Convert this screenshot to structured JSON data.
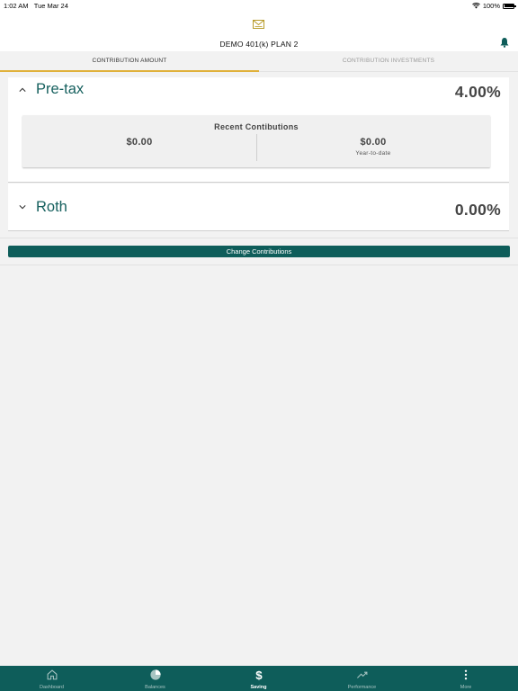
{
  "status_bar": {
    "time": "1:02 AM",
    "date": "Tue Mar 24",
    "battery": "100%"
  },
  "header": {
    "plan_name": "DEMO 401(k) PLAN 2"
  },
  "tabs": [
    {
      "label": "CONTRIBUTION AMOUNT",
      "active": true
    },
    {
      "label": "CONTRIBUTION INVESTMENTS",
      "active": false
    }
  ],
  "pretax": {
    "label": "Pre-tax",
    "percent": "4.00%",
    "expanded": true,
    "recent": {
      "title": "Recent Contibutions",
      "left_amount": "$0.00",
      "right_amount": "$0.00",
      "right_caption": "Year-to-date"
    }
  },
  "roth": {
    "label": "Roth",
    "percent": "0.00%",
    "expanded": false
  },
  "change_button": "Change Contributions",
  "bottom_nav": [
    {
      "label": "Dashboard",
      "icon": "home-icon",
      "active": false
    },
    {
      "label": "Balances",
      "icon": "pie-chart-icon",
      "active": false
    },
    {
      "label": "Saving",
      "icon": "dollar-icon",
      "active": true
    },
    {
      "label": "Performance",
      "icon": "trend-icon",
      "active": false
    },
    {
      "label": "More",
      "icon": "more-vertical-icon",
      "active": false
    }
  ],
  "colors": {
    "primary": "#0e5d5a",
    "accent": "#e0b13a",
    "label_teal": "#17615f",
    "logo_gold": "#b89b2a"
  }
}
